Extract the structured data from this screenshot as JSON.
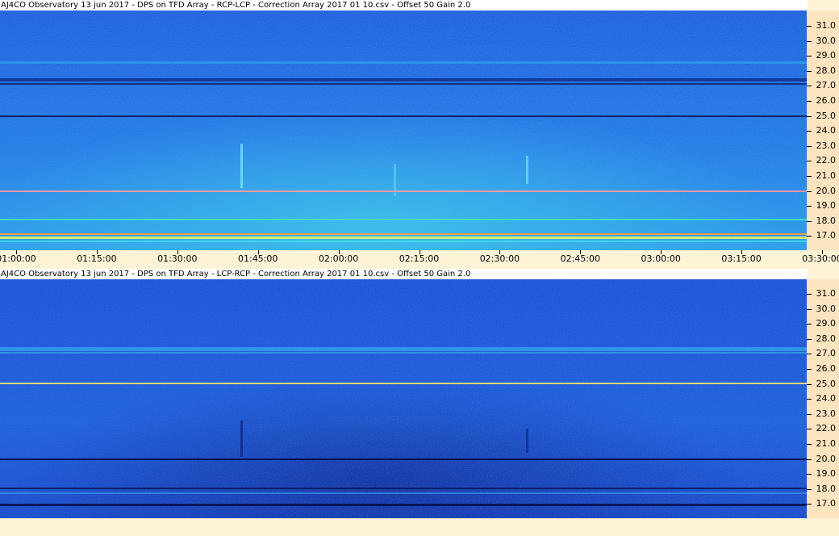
{
  "panels": [
    {
      "id": "rcp-lcp",
      "title": "AJ4CO Observatory 13 jun 2017  -  DPS on TFD Array  -  RCP-LCP  -  Correction Array 2017 01 10.csv  -  Offset 50  Gain 2.0",
      "base_color": "#1f66e0",
      "tint_color": "#2fb4f0"
    },
    {
      "id": "lcp-rcp",
      "title": "AJ4CO Observatory 13 jun 2017  -  DPS on TFD Array  -  LCP-RCP  -  Correction Array 2017 01 10.csv  -  Offset 50  Gain 2.0",
      "base_color": "#1f52d8",
      "tint_color": "#2b7ae8"
    }
  ],
  "frequency_ticks": [
    "31.0",
    "30.0",
    "29.0",
    "28.0",
    "27.0",
    "26.0",
    "25.0",
    "24.0",
    "23.0",
    "22.0",
    "21.0",
    "20.0",
    "19.0",
    "18.0",
    "17.0"
  ],
  "time_ticks": [
    "01:00:00",
    "01:15:00",
    "01:30:00",
    "01:45:00",
    "02:00:00",
    "02:15:00",
    "02:30:00",
    "02:45:00",
    "03:00:00",
    "03:15:00",
    "03:30:00"
  ]
}
